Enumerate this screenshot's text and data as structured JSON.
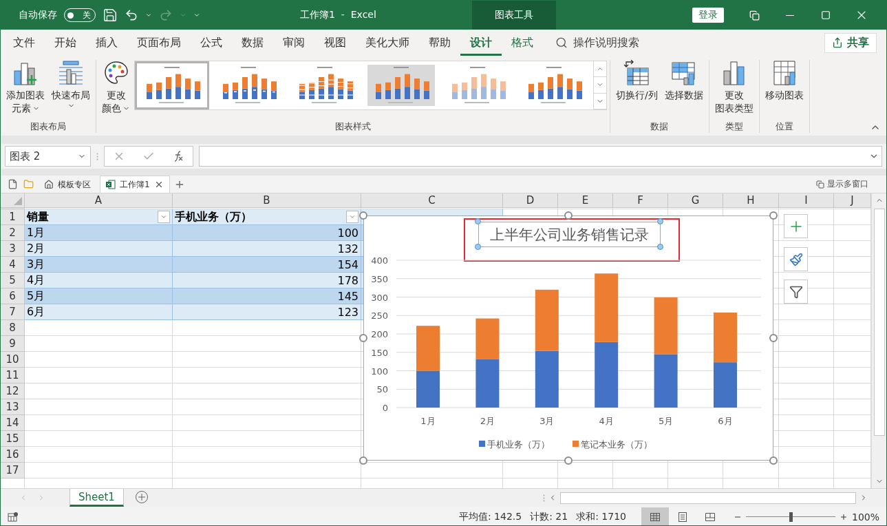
{
  "title_bar": {
    "autosave_label": "自动保存",
    "autosave": {
      "on": false,
      "text": "关"
    },
    "title": "工作簿1  -  Excel",
    "context_tab": "图表工具",
    "sign_in": "登录"
  },
  "menu_tabs": [
    {
      "label": "文件",
      "selected": false,
      "contextual": false
    },
    {
      "label": "开始",
      "selected": false,
      "contextual": false
    },
    {
      "label": "插入",
      "selected": false,
      "contextual": false
    },
    {
      "label": "页面布局",
      "selected": false,
      "contextual": false
    },
    {
      "label": "公式",
      "selected": false,
      "contextual": false
    },
    {
      "label": "数据",
      "selected": false,
      "contextual": false
    },
    {
      "label": "审阅",
      "selected": false,
      "contextual": false
    },
    {
      "label": "视图",
      "selected": false,
      "contextual": false
    },
    {
      "label": "美化大师",
      "selected": false,
      "contextual": false
    },
    {
      "label": "帮助",
      "selected": false,
      "contextual": false
    },
    {
      "label": "设计",
      "selected": true,
      "contextual": true
    },
    {
      "label": "格式",
      "selected": false,
      "contextual": true
    }
  ],
  "tell_me": "操作说明搜索",
  "share": "共享",
  "ribbon_groups": [
    {
      "title": "图表布局",
      "buttons": [
        {
          "kind": "add-element",
          "lines": [
            "添加图表",
            "元素"
          ],
          "dropdown": true
        },
        {
          "kind": "quick-layout",
          "lines": [
            "快速布局"
          ],
          "dropdown": true
        }
      ]
    },
    {
      "title": "图表样式",
      "buttons": [
        {
          "kind": "colors",
          "lines": [
            "更改",
            "颜色"
          ],
          "dropdown": true
        }
      ],
      "gallery": [
        {
          "selected": true
        },
        {
          "selected": false
        },
        {
          "selected": false
        },
        {
          "selected": false
        },
        {
          "selected": false
        },
        {
          "selected": false
        }
      ]
    },
    {
      "title": "数据",
      "buttons": [
        {
          "kind": "switch",
          "lines": [
            "切换行/列"
          ],
          "dropdown": false
        },
        {
          "kind": "select-data",
          "lines": [
            "选择数据"
          ],
          "dropdown": false
        }
      ]
    },
    {
      "title": "类型",
      "buttons": [
        {
          "kind": "change-type",
          "lines": [
            "更改",
            "图表类型"
          ],
          "dropdown": false
        }
      ]
    },
    {
      "title": "位置",
      "buttons": [
        {
          "kind": "move",
          "lines": [
            "移动图表"
          ],
          "dropdown": false
        }
      ]
    }
  ],
  "formula_bar": {
    "name_box": "图表 2"
  },
  "workbook_tabs": {
    "tabs": [
      {
        "kind": "home",
        "label": "模板专区",
        "selected": false,
        "closable": false
      },
      {
        "kind": "excel",
        "label": "工作簿1",
        "selected": true,
        "closable": true
      }
    ],
    "show_windows": "显示多窗口"
  },
  "sheet": {
    "columns": [
      "A",
      "B",
      "C",
      "D",
      "E",
      "F",
      "G",
      "H",
      "I",
      "J"
    ],
    "row_numbers": [
      "1",
      "2",
      "3",
      "4",
      "5",
      "6",
      "7",
      "8",
      "9",
      "10",
      "11",
      "12",
      "13",
      "14",
      "15",
      "16",
      "17"
    ],
    "table": {
      "headers": [
        "销量",
        "手机业务（万）"
      ],
      "rows": [
        [
          "1月",
          "100"
        ],
        [
          "2月",
          "132"
        ],
        [
          "3月",
          "154"
        ],
        [
          "4月",
          "178"
        ],
        [
          "5月",
          "145"
        ],
        [
          "6月",
          "123"
        ]
      ]
    }
  },
  "chart": {
    "selected": true,
    "title_selected": true,
    "title_highlighted": true,
    "chart_data": {
      "type": "bar",
      "title": "上半年公司业务销售记录",
      "categories": [
        "1月",
        "2月",
        "3月",
        "4月",
        "5月",
        "6月"
      ],
      "stacked": true,
      "grid": true,
      "legend": "bottom",
      "ylim": [
        0,
        400
      ],
      "yticks": [
        0,
        50,
        100,
        150,
        200,
        250,
        300,
        350,
        400
      ],
      "series": [
        {
          "name": "手机业务（万）",
          "color": "#4472c4",
          "values": [
            100,
            132,
            154,
            178,
            145,
            123
          ]
        },
        {
          "name": "笔记本业务（万）",
          "color": "#ed7d31",
          "values": [
            122,
            110,
            166,
            186,
            154,
            135
          ]
        }
      ]
    }
  },
  "sheet_tabs": [
    {
      "label": "Sheet1",
      "selected": true
    }
  ],
  "status_bar": {
    "stats": [
      "平均值: 142.5",
      "计数: 21",
      "求和: 1710"
    ],
    "views": [
      {
        "kind": "normal",
        "selected": true
      },
      {
        "kind": "page-layout",
        "selected": false
      },
      {
        "kind": "page-break",
        "selected": false
      }
    ],
    "zoom": {
      "level": 0.5,
      "text": "100%"
    }
  }
}
